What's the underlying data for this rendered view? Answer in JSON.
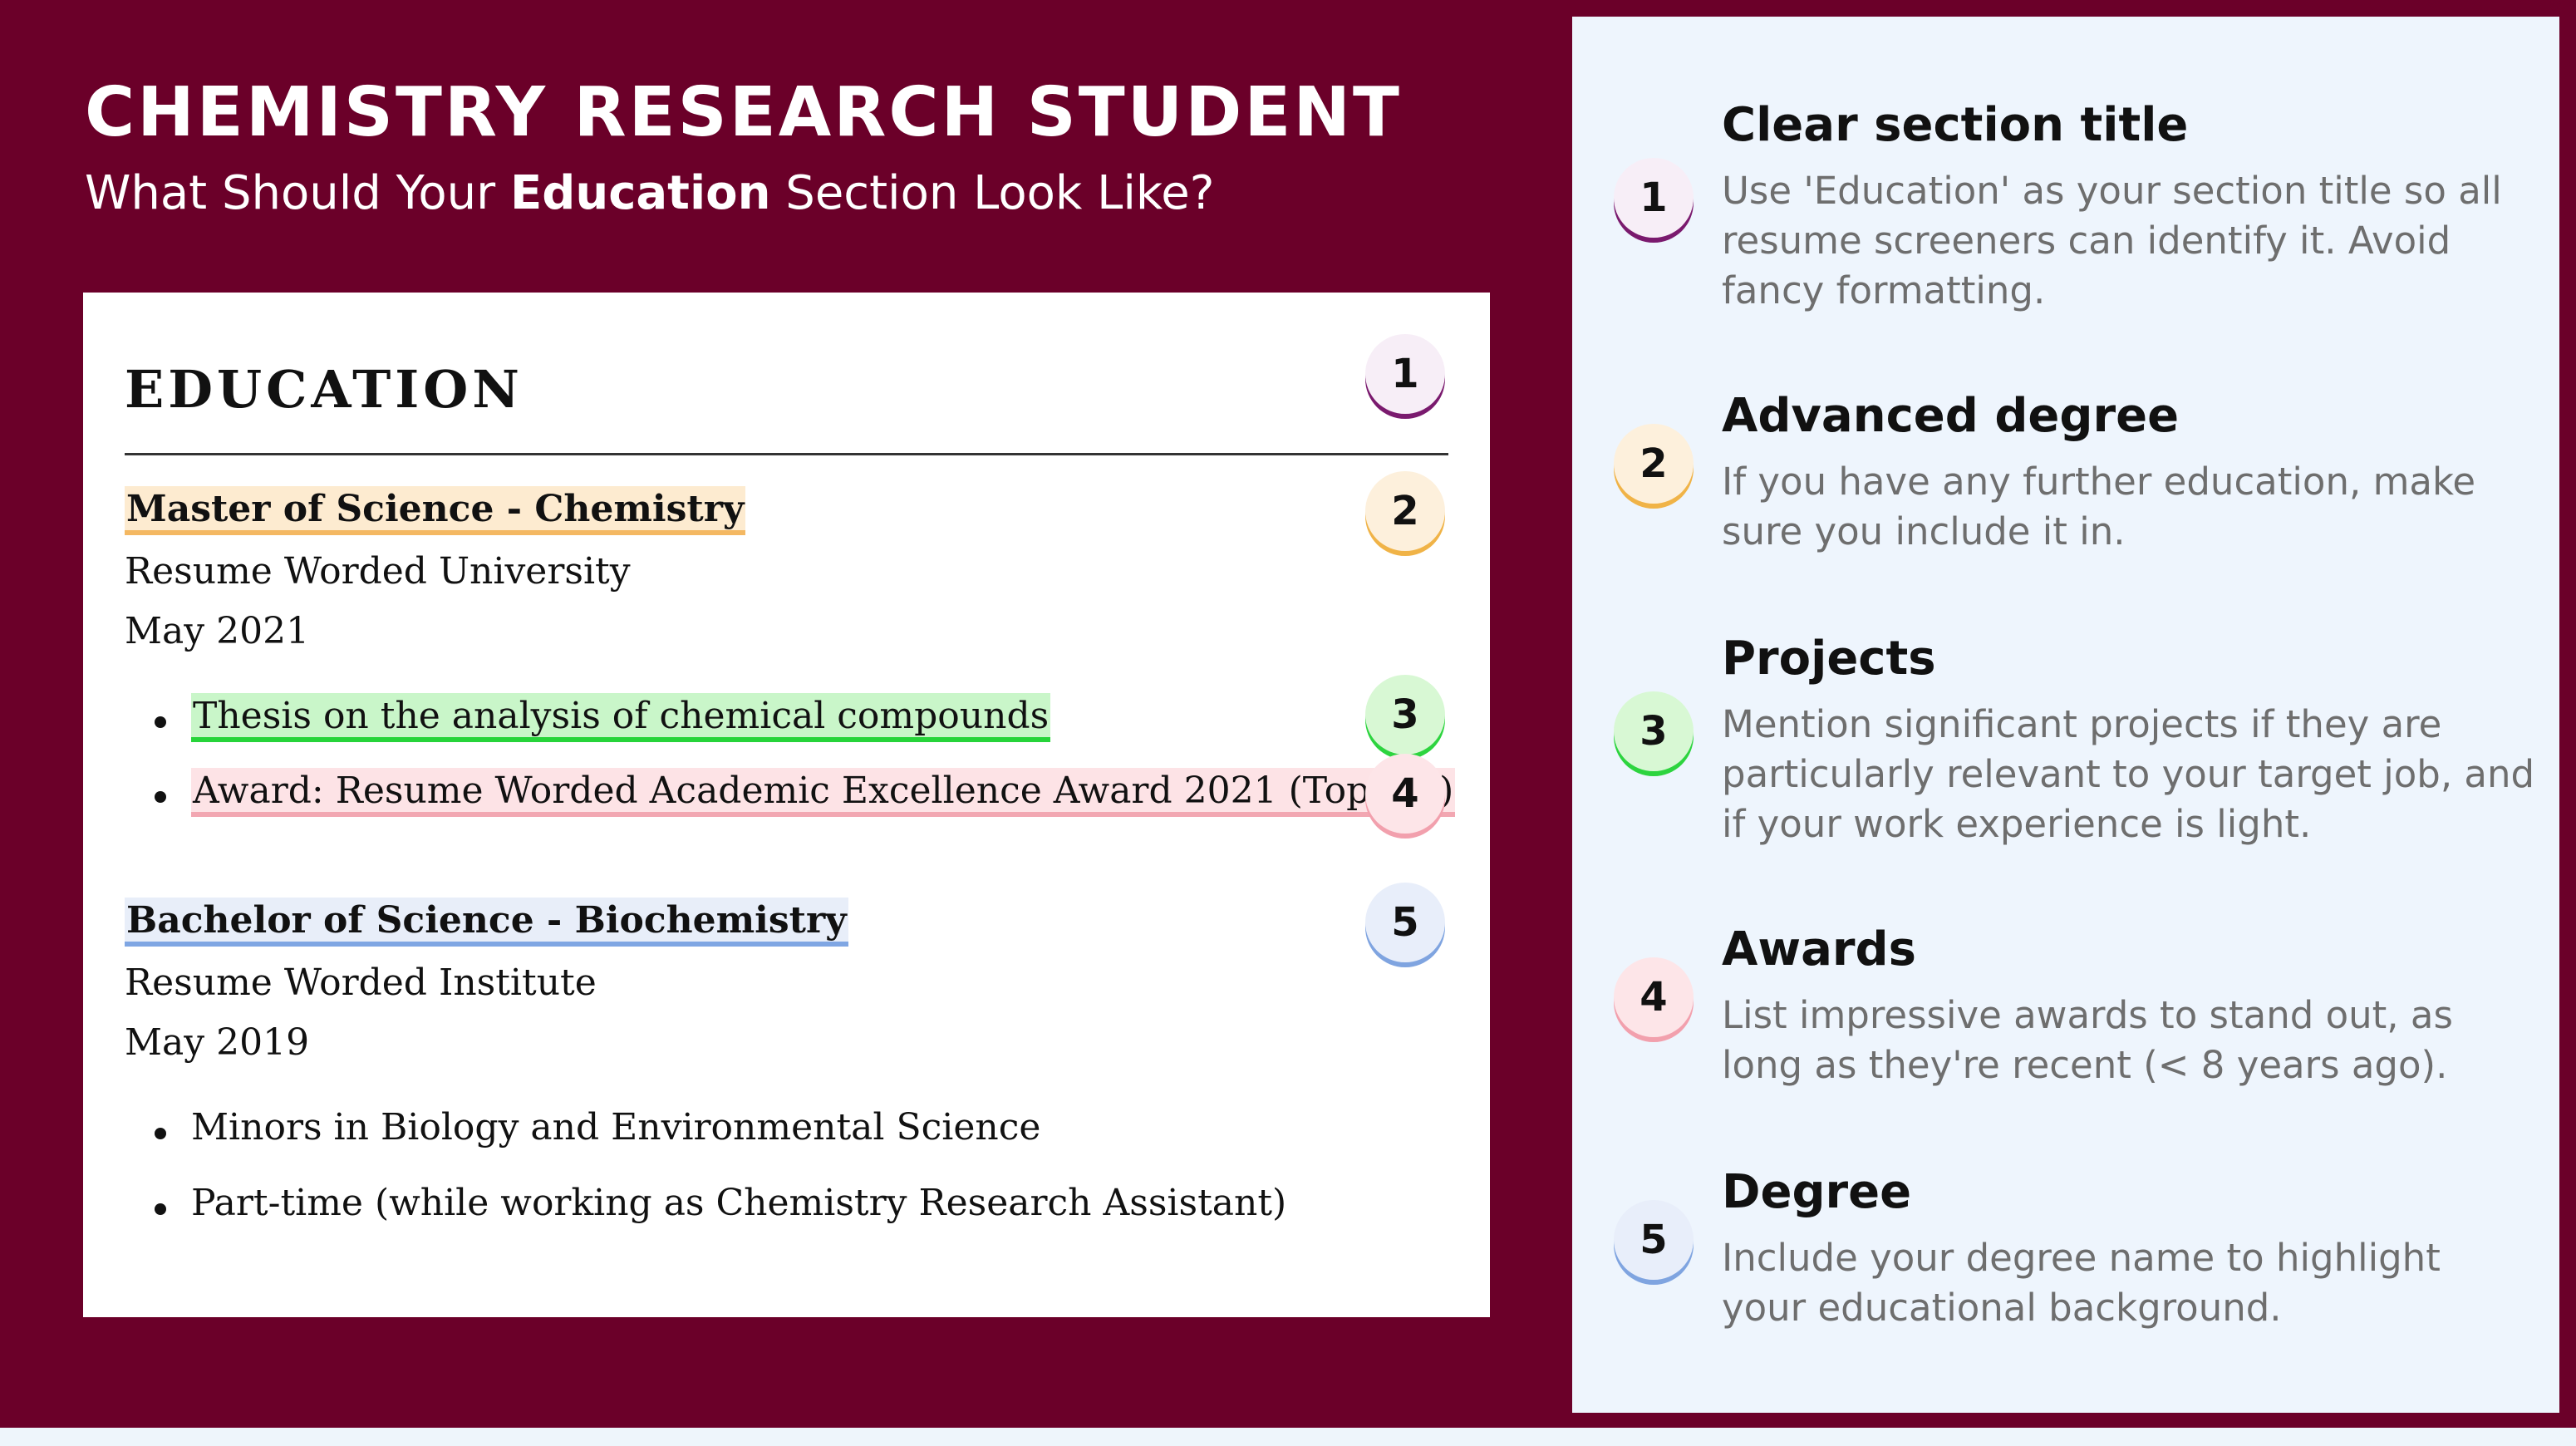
{
  "header": {
    "title": "CHEMISTRY RESEARCH STUDENT",
    "subtitle_prefix": "What Should Your ",
    "subtitle_emphasis": "Education",
    "subtitle_suffix": " Section Look Like?"
  },
  "resume": {
    "section_title": "EDUCATION",
    "entries": [
      {
        "degree": "Master of Science - Chemistry",
        "school": "Resume Worded University",
        "date": "May 2021",
        "bullets": [
          "Thesis on the analysis of chemical compounds",
          "Award: Resume Worded Academic Excellence Award 2021 (Top 5%)"
        ]
      },
      {
        "degree": "Bachelor of Science - Biochemistry",
        "school": "Resume Worded Institute",
        "date": "May 2019",
        "bullets": [
          "Minors in Biology and Environmental Science",
          "Part-time (while working as Chemistry Research Assistant)"
        ]
      }
    ]
  },
  "markers": [
    "1",
    "2",
    "3",
    "4",
    "5"
  ],
  "tips": [
    {
      "number": "1",
      "title": "Clear section title",
      "text": "Use 'Education' as your section title so all resume screeners can identify it. Avoid fancy formatting."
    },
    {
      "number": "2",
      "title": "Advanced degree",
      "text": "If you have any further education, make sure you include it in."
    },
    {
      "number": "3",
      "title": "Projects",
      "text": "Mention significant projects if they are particularly relevant to your target job, and if your work experience is light."
    },
    {
      "number": "4",
      "title": "Awards",
      "text": "List impressive awards to stand out, as long as they're recent (< 8 years ago)."
    },
    {
      "number": "5",
      "title": "Degree",
      "text": "Include your degree name to highlight your educational background."
    }
  ],
  "colors": {
    "background": "#6b0029",
    "panel": "#eef5fd",
    "marker1": "#7a1a6e",
    "marker2": "#f0b347",
    "marker3": "#2dd43f",
    "marker4": "#f2a0ad",
    "marker5": "#7fa4e0"
  }
}
